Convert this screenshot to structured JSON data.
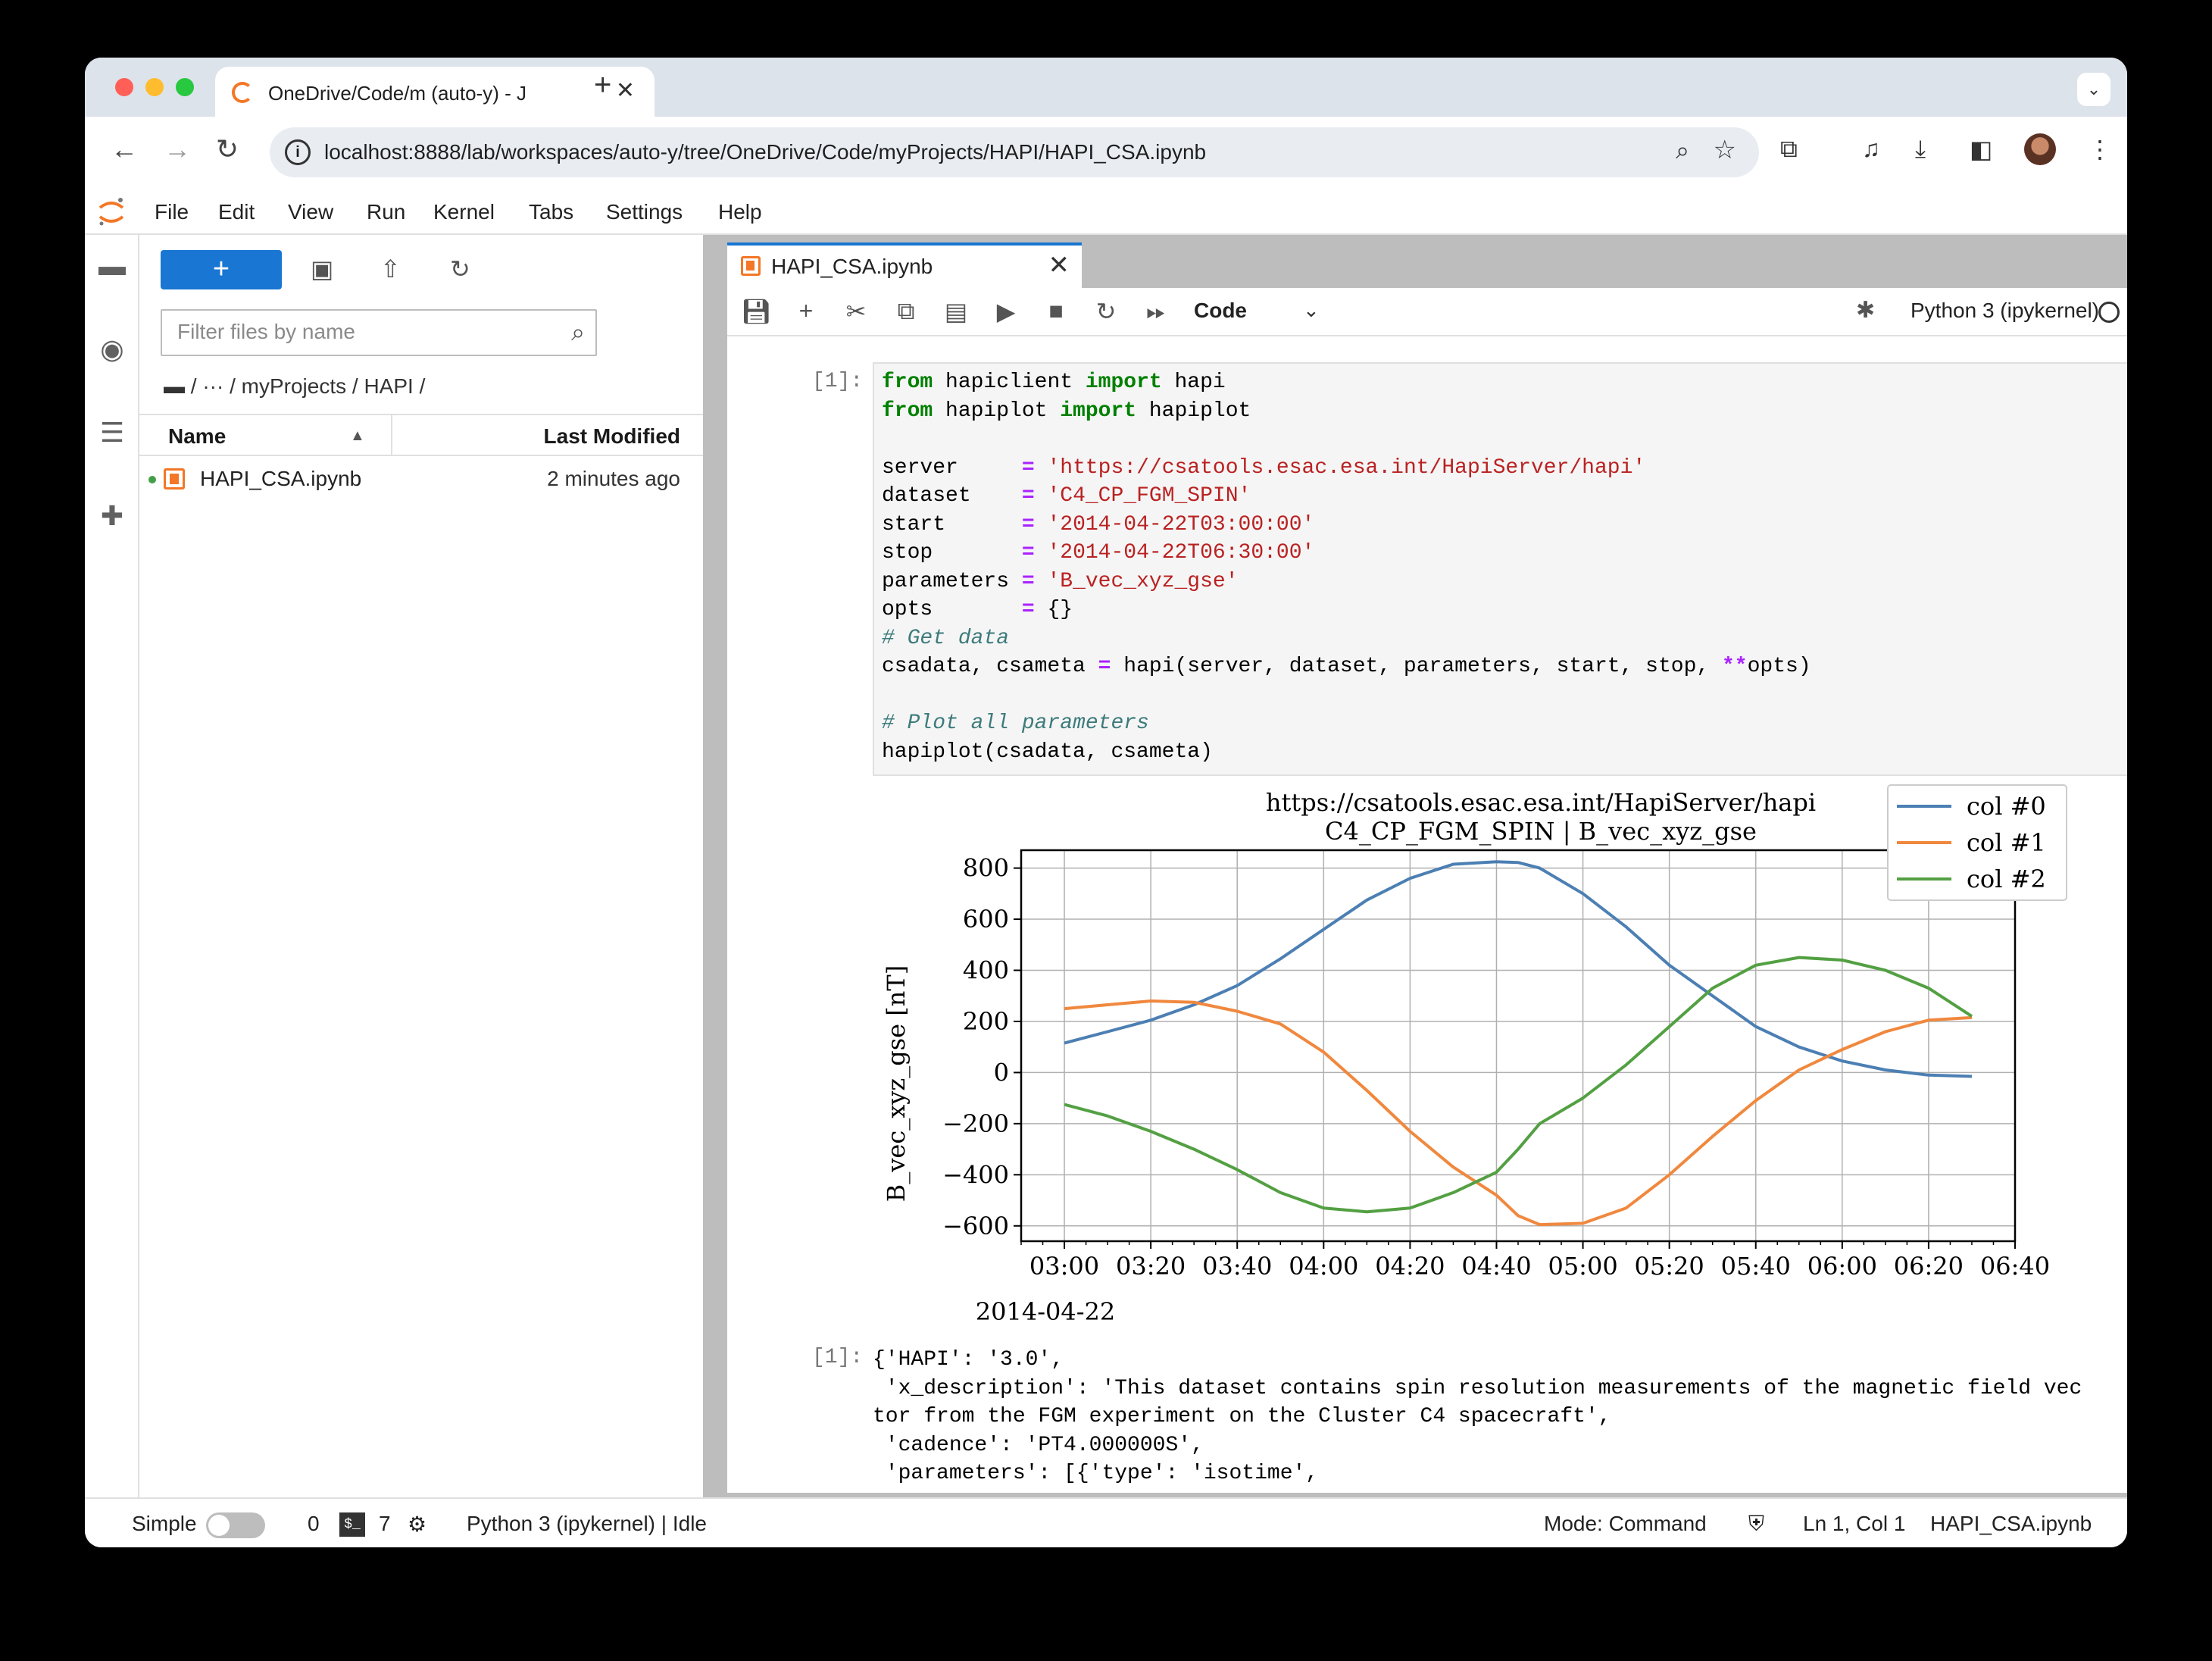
{
  "browser": {
    "tab_title": "OneDrive/Code/m (auto-y) - J",
    "tab_close": "✕",
    "new_tab": "+",
    "url": "localhost:8888/lab/workspaces/auto-y/tree/OneDrive/Code/myProjects/HAPI/HAPI_CSA.ipynb"
  },
  "menubar": {
    "items": [
      "File",
      "Edit",
      "View",
      "Run",
      "Kernel",
      "Tabs",
      "Settings",
      "Help"
    ]
  },
  "filebrowser": {
    "new_label": "+",
    "filter_placeholder": "Filter files by name",
    "breadcrumb": "/  ···  / myProjects / HAPI /",
    "col_name": "Name",
    "col_modified": "Last Modified",
    "files": [
      {
        "name": "HAPI_CSA.ipynb",
        "modified": "2 minutes ago"
      }
    ]
  },
  "notebook": {
    "tab_title": "HAPI_CSA.ipynb",
    "cell_type": "Code",
    "kernel": "Python 3 (ipykernel)",
    "in_prompt": "[1]:",
    "out_prompt": "[1]:",
    "output_lines": [
      "{'HAPI': '3.0',",
      " 'x_description': 'This dataset contains spin resolution measurements of the magnetic field vec",
      "tor from the FGM experiment on the Cluster C4 spacecraft',",
      " 'cadence': 'PT4.000000S',",
      " 'parameters': [{'type': 'isotime',"
    ]
  },
  "chart_data": {
    "type": "line",
    "title": "https://csatools.esac.esa.int/HapiServer/hapi",
    "subtitle": "C4_CP_FGM_SPIN | B_vec_xyz_gse",
    "xlabel": "",
    "ylabel": "B_vec_xyz_gse [nT]",
    "x_date_label": "2014-04-22",
    "x_tick_labels": [
      "03:00",
      "03:20",
      "03:40",
      "04:00",
      "04:20",
      "04:40",
      "05:00",
      "05:20",
      "05:40",
      "06:00",
      "06:20",
      "06:40"
    ],
    "y_ticks": [
      -600,
      -400,
      -200,
      0,
      200,
      400,
      600,
      800
    ],
    "xlim": [
      "2014-04-22T02:50",
      "2014-04-22T06:40"
    ],
    "ylim": [
      -660,
      870
    ],
    "grid": true,
    "legend_position": "top-right",
    "x": [
      "2014-04-22T03:00",
      "2014-04-22T03:10",
      "2014-04-22T03:20",
      "2014-04-22T03:30",
      "2014-04-22T03:40",
      "2014-04-22T03:50",
      "2014-04-22T04:00",
      "2014-04-22T04:10",
      "2014-04-22T04:20",
      "2014-04-22T04:30",
      "2014-04-22T04:40",
      "2014-04-22T04:45",
      "2014-04-22T04:50",
      "2014-04-22T05:00",
      "2014-04-22T05:10",
      "2014-04-22T05:20",
      "2014-04-22T05:30",
      "2014-04-22T05:40",
      "2014-04-22T05:50",
      "2014-04-22T06:00",
      "2014-04-22T06:10",
      "2014-04-22T06:20",
      "2014-04-22T06:30"
    ],
    "series": [
      {
        "name": "col #0",
        "color": "#4c7fb3",
        "values": [
          115,
          160,
          205,
          265,
          340,
          445,
          560,
          675,
          760,
          815,
          825,
          822,
          800,
          700,
          570,
          420,
          300,
          180,
          100,
          45,
          10,
          -10,
          -15
        ]
      },
      {
        "name": "col #1",
        "color": "#f0883e",
        "values": [
          250,
          265,
          280,
          275,
          240,
          190,
          80,
          -70,
          -230,
          -370,
          -480,
          -560,
          -595,
          -590,
          -530,
          -400,
          -250,
          -110,
          10,
          90,
          160,
          205,
          215
        ]
      },
      {
        "name": "col #2",
        "color": "#53a043",
        "values": [
          -125,
          -170,
          -230,
          -300,
          -380,
          -470,
          -530,
          -545,
          -530,
          -470,
          -390,
          -300,
          -200,
          -100,
          30,
          180,
          330,
          420,
          450,
          440,
          400,
          330,
          220
        ]
      }
    ]
  }
}
